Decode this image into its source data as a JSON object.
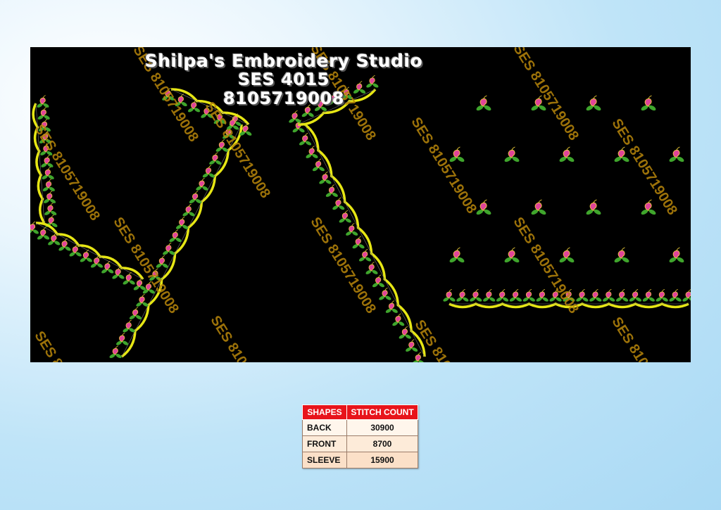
{
  "header": {
    "studio_name": "Shilpa's Embroidery Studio",
    "design_code": "SES 4015",
    "phone": "8105719008"
  },
  "watermark": {
    "text": "SES 8105719008",
    "color": "#b8860b"
  },
  "colors": {
    "background_panel": "#000000",
    "border_yellow": "#e6e614",
    "leaf_green": "#3fa52c",
    "paisley_pink": "#e0449a",
    "table_header_red": "#e8141b"
  },
  "stitch_table": {
    "headers": [
      "SHAPES",
      "STITCH COUNT"
    ],
    "rows": [
      {
        "shape": "BACK",
        "count": "30900"
      },
      {
        "shape": "FRONT",
        "count": "8700"
      },
      {
        "shape": "SLEEVE",
        "count": "15900"
      }
    ]
  }
}
